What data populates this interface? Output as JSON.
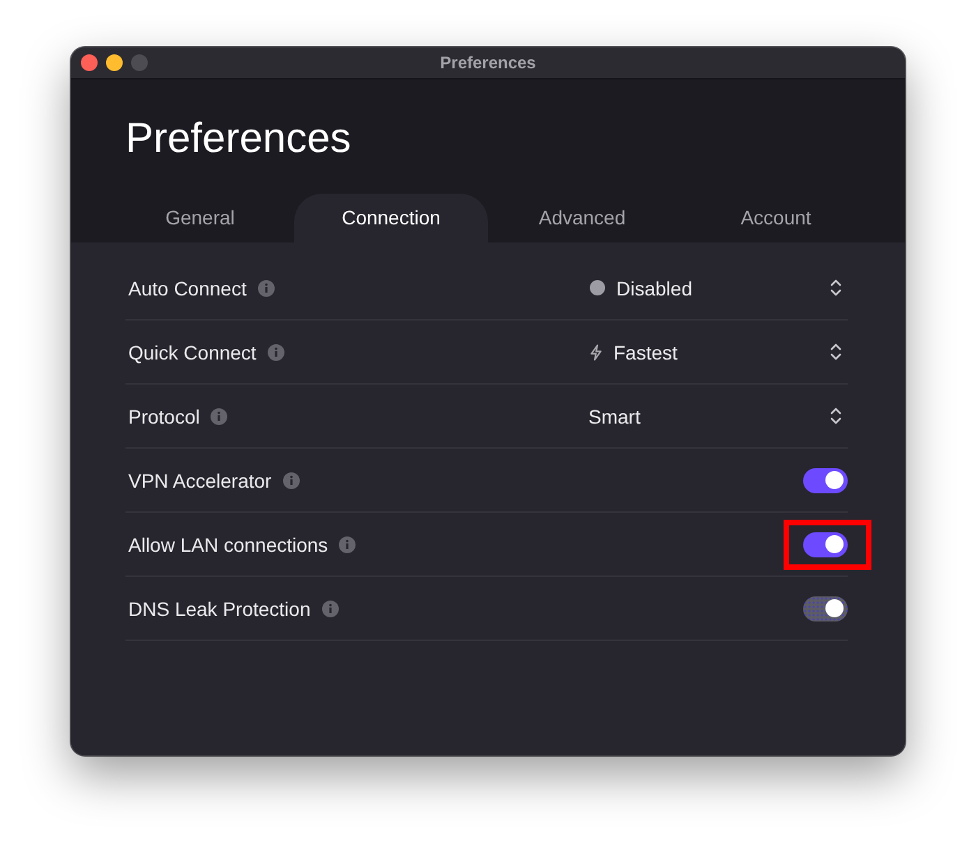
{
  "window": {
    "title": "Preferences",
    "controls": [
      {
        "kind": "close",
        "disabled": false
      },
      {
        "kind": "minimize",
        "disabled": false
      },
      {
        "kind": "zoom",
        "disabled": true
      }
    ]
  },
  "heading": "Preferences",
  "tabs": [
    {
      "label": "General",
      "selected": false
    },
    {
      "label": "Connection",
      "selected": true
    },
    {
      "label": "Advanced",
      "selected": false
    },
    {
      "label": "Account",
      "selected": false
    }
  ],
  "settings": [
    {
      "kind": "status-select",
      "label": "Auto Connect",
      "value": "Disabled",
      "highlighted": false
    },
    {
      "kind": "profile-select",
      "label": "Quick Connect",
      "value": "Fastest",
      "highlighted": false
    },
    {
      "kind": "select",
      "label": "Protocol",
      "value": "Smart",
      "highlighted": false
    },
    {
      "kind": "toggle",
      "label": "VPN Accelerator",
      "on": true,
      "disabled": false,
      "highlighted": false
    },
    {
      "kind": "toggle",
      "label": "Allow LAN connections",
      "on": true,
      "disabled": false,
      "highlighted": true
    },
    {
      "kind": "toggle",
      "label": "DNS Leak Protection",
      "on": true,
      "disabled": true,
      "highlighted": false
    }
  ]
}
